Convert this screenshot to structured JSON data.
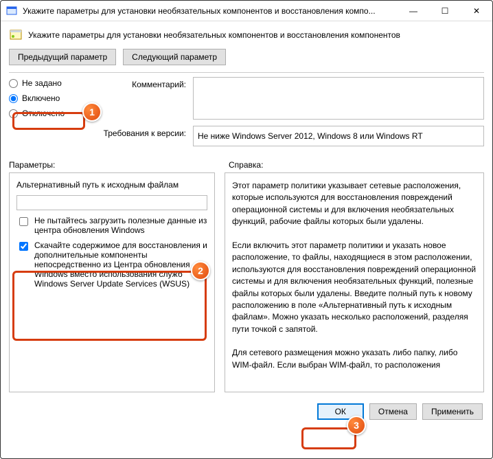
{
  "window": {
    "title": "Укажите параметры для установки необязательных компонентов и восстановления компо...",
    "header": "Укажите параметры для установки необязательных компонентов и восстановления компонентов"
  },
  "nav": {
    "prev": "Предыдущий параметр",
    "next": "Следующий параметр"
  },
  "radios": {
    "not_set": "Не задано",
    "enabled": "Включено",
    "disabled": "Отключено"
  },
  "labels": {
    "comment": "Комментарий:",
    "requirements": "Требования к версии:",
    "parameters": "Параметры:",
    "help": "Справка:"
  },
  "requirements_text": "Не ниже Windows Server 2012, Windows 8 или Windows RT",
  "params": {
    "alt_path_label": "Альтернативный путь к исходным файлам",
    "alt_path_value": "",
    "chk_no_wu": "Не пытайтесь загрузить полезные данные из центра обновления Windows",
    "chk_wsus": "Скачайте содержимое для восстановления и дополнительные компоненты непосредственно из Центра обновления Windows вместо использования служб Windows Server Update Services (WSUS)"
  },
  "help_text": "Этот параметр политики указывает сетевые расположения, которые используются для восстановления повреждений операционной системы и для включения необязательных функций, рабочие файлы которых были удалены.\n\nЕсли включить этот параметр политики и указать новое расположение, то файлы, находящиеся в этом расположении, используются для восстановления повреждений операционной системы и для включения необязательных функций, полезные файлы которых были удалены. Введите полный путь к новому расположению в поле «Альтернативный путь к исходным файлам». Можно указать несколько расположений, разделяя пути точкой с запятой.\n\nДля сетевого размещения можно указать либо папку, либо WIM-файл. Если выбран WIM-файл, то расположения",
  "footer": {
    "ok": "ОК",
    "cancel": "Отмена",
    "apply": "Применить"
  },
  "badges": {
    "b1": "1",
    "b2": "2",
    "b3": "3"
  }
}
